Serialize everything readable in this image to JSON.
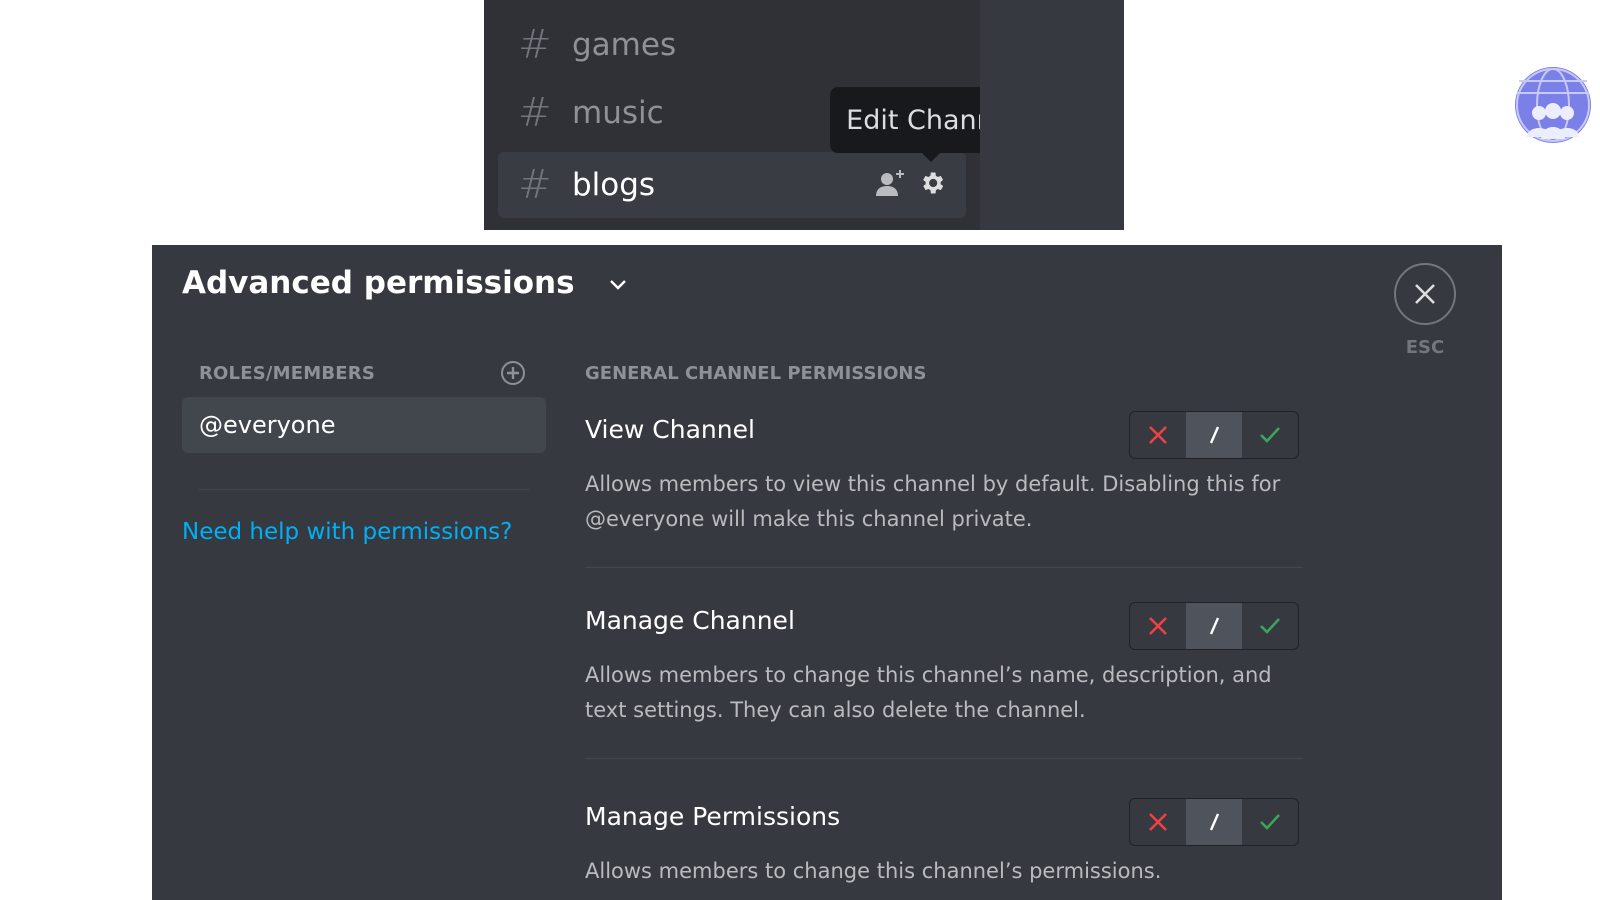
{
  "channel_list": {
    "channels": [
      {
        "name": "games",
        "active": false
      },
      {
        "name": "music",
        "active": false
      },
      {
        "name": "blogs",
        "active": true
      }
    ],
    "hash_symbol": "#",
    "active_row_icons": [
      "invite-member-icon",
      "gear-icon"
    ],
    "tooltip": "Edit Channel",
    "server_avatar": "server-avatar-globe-people"
  },
  "permissions_modal": {
    "title": "Advanced permissions",
    "close_label": "ESC",
    "roles_header": "ROLES/MEMBERS",
    "roles": [
      "@everyone"
    ],
    "help_link": "Need help with permissions?",
    "section_header": "GENERAL CHANNEL PERMISSIONS",
    "permissions": [
      {
        "name": "View Channel",
        "description": "Allows members to view this channel by default. Disabling this for @everyone will make this channel private.",
        "state": "neutral"
      },
      {
        "name": "Manage Channel",
        "description": "Allows members to change this channel’s name, description, and text settings. They can also delete the channel.",
        "state": "neutral"
      },
      {
        "name": "Manage Permissions",
        "description": "Allows members to change this channel’s permissions.",
        "state": "neutral"
      }
    ],
    "toggle_options": [
      "deny",
      "neutral",
      "allow"
    ]
  },
  "colors": {
    "deny": "#ed4245",
    "allow": "#3ba55d",
    "link": "#00b0f4",
    "avatar": "#7b80e8"
  }
}
